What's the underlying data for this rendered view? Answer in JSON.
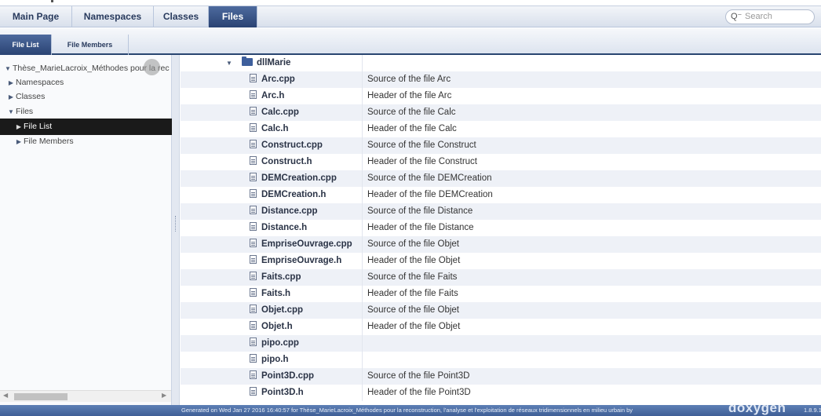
{
  "tabs": {
    "main": [
      "Main Page",
      "Namespaces",
      "Classes",
      "Files"
    ],
    "active_main": "Files",
    "sub": [
      "File List",
      "File Members"
    ],
    "active_sub": "File List"
  },
  "search": {
    "placeholder": "Search",
    "icon": "search-icon"
  },
  "nav": {
    "items": [
      {
        "label": "Thèse_MarieLacroix_Méthodes pour la rec",
        "arrow": "▼"
      },
      {
        "label": "Namespaces",
        "arrow": "▶"
      },
      {
        "label": "Classes",
        "arrow": "▶"
      },
      {
        "label": "Files",
        "arrow": "▼"
      },
      {
        "label": "File List",
        "arrow": "▶"
      },
      {
        "label": "File Members",
        "arrow": "▶"
      }
    ],
    "selected": "File List"
  },
  "files": {
    "folder": {
      "name": "dllMarie",
      "arrow": "▼"
    },
    "rows": [
      {
        "name": "Arc.cpp",
        "desc": "Source of the file Arc"
      },
      {
        "name": "Arc.h",
        "desc": "Header of the file Arc"
      },
      {
        "name": "Calc.cpp",
        "desc": "Source of the file Calc"
      },
      {
        "name": "Calc.h",
        "desc": "Header of the file Calc"
      },
      {
        "name": "Construct.cpp",
        "desc": "Source of the file Construct"
      },
      {
        "name": "Construct.h",
        "desc": "Header of the file Construct"
      },
      {
        "name": "DEMCreation.cpp",
        "desc": "Source of the file DEMCreation"
      },
      {
        "name": "DEMCreation.h",
        "desc": "Header of the file DEMCreation"
      },
      {
        "name": "Distance.cpp",
        "desc": "Source of the file Distance"
      },
      {
        "name": "Distance.h",
        "desc": "Header of the file Distance"
      },
      {
        "name": "EmpriseOuvrage.cpp",
        "desc": "Source of the file Objet"
      },
      {
        "name": "EmpriseOuvrage.h",
        "desc": "Header of the file Objet"
      },
      {
        "name": "Faits.cpp",
        "desc": "Source of the file Faits"
      },
      {
        "name": "Faits.h",
        "desc": "Header of the file Faits"
      },
      {
        "name": "Objet.cpp",
        "desc": "Source of the file Objet"
      },
      {
        "name": "Objet.h",
        "desc": "Header of the file Objet"
      },
      {
        "name": "pipo.cpp",
        "desc": ""
      },
      {
        "name": "pipo.h",
        "desc": ""
      },
      {
        "name": "Point3D.cpp",
        "desc": "Source of the file Point3D"
      },
      {
        "name": "Point3D.h",
        "desc": "Header of the file Point3D"
      }
    ]
  },
  "footer": {
    "generated": "Generated on Wed Jan 27 2016 16:40:57 for Thèse_MarieLacroix_Méthodes pour la reconstruction, l'analyse et l'exploitation de réseaux tridimensionnels en milieu urbain by",
    "logo": "doxygen",
    "version": "1.8.9.1"
  }
}
